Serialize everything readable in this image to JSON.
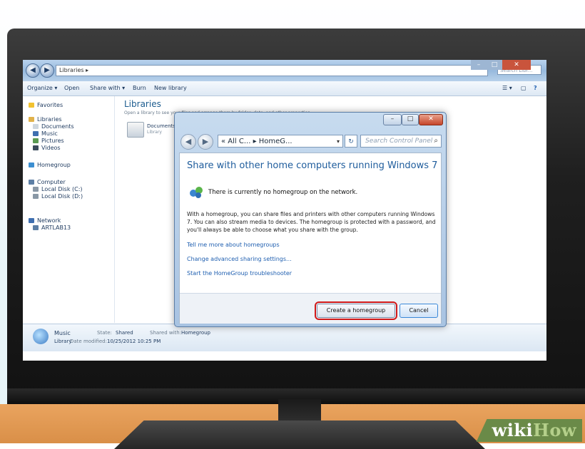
{
  "explorer": {
    "address": "Libraries ▸",
    "search_placeholder": "Search Libr...",
    "toolbar": {
      "organize": "Organize ▾",
      "open": "Open",
      "share_with": "Share with ▾",
      "burn": "Burn",
      "new_library": "New library"
    },
    "sidebar": {
      "favorites": "Favorites",
      "libraries": "Libraries",
      "documents": "Documents",
      "music": "Music",
      "pictures": "Pictures",
      "videos": "Videos",
      "homegroup": "Homegroup",
      "computer": "Computer",
      "local_disk_c": "Local Disk (C:)",
      "local_disk_d": "Local Disk (D:)",
      "network": "Network",
      "network_pc": "ARTLAB13"
    },
    "content": {
      "title": "Libraries",
      "subtitle": "Open a library to see your files and arrange them by folder, date, and other properties.",
      "doc_label": "Documents",
      "doc_sub": "Library"
    },
    "details": {
      "name": "Music",
      "type": "Library",
      "state_label": "State:",
      "state_value": "Shared",
      "date_label": "Date modified:",
      "date_value": "10/25/2012 10:25 PM",
      "shared_label": "Shared with:",
      "shared_value": "Homegroup"
    }
  },
  "dialog": {
    "address": "« All C... ▸ HomeG...",
    "search_placeholder": "Search Control Panel",
    "heading": "Share with other home computers running Windows 7",
    "status": "There is currently no homegroup on the network.",
    "description": "With a homegroup, you can share files and printers with other computers running Windows 7. You can also stream media to devices. The homegroup is protected with a password, and you'll always be able to choose what you share with the group.",
    "links": [
      "Tell me more about homegroups",
      "Change advanced sharing settings...",
      "Start the HomeGroup troubleshooter"
    ],
    "create_button": "Create a homegroup",
    "cancel_button": "Cancel",
    "highlight_color": "#d01919"
  },
  "watermark": {
    "wiki": "wiki",
    "how": "How"
  }
}
